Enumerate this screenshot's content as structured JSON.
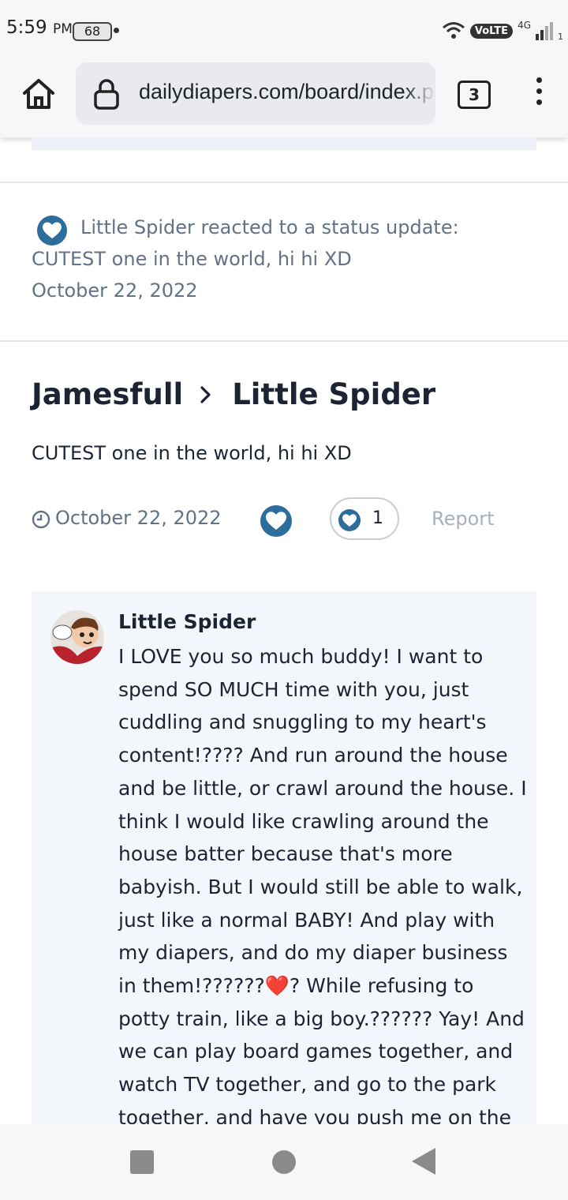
{
  "status_bar": {
    "time": "5:59",
    "ampm": "PM",
    "battery": "68",
    "network_badge": "VoLTE",
    "network_type": "4G",
    "sim_slot": "1"
  },
  "browser": {
    "url": "dailydiapers.com/board/index.php",
    "tab_count": "3"
  },
  "activity": {
    "line1": "Little Spider reacted to a status update:",
    "line2": "CUTEST one in the world, hi hi XD",
    "line3": "October 22, 2022"
  },
  "post": {
    "author_from": "Jamesfull",
    "author_to": "Little Spider",
    "status_text": "CUTEST one in the world, hi hi XD",
    "date": "October 22, 2022",
    "reaction_count": "1",
    "report_label": "Report"
  },
  "comment": {
    "author": "Little Spider",
    "body": "I LOVE you so much buddy! I want to spend SO MUCH time with you, just cuddling and snuggling to my heart's content!???? And run around the house and be little, or crawl around the house. I think I would like crawling around the house batter because that's more babyish. But I would still be able to walk, just like a normal BABY! And play with my diapers, and do my diaper business in them!??????❤️? While refusing to potty train, like a big boy.?????? Yay! And we can play board games together, and watch TV together, and go to the park together, and have you push me on the"
  },
  "colors": {
    "accent": "#2c6d9c",
    "muted_text": "#637188",
    "heading": "#1c2434",
    "comment_bg": "#f3f6fa"
  }
}
